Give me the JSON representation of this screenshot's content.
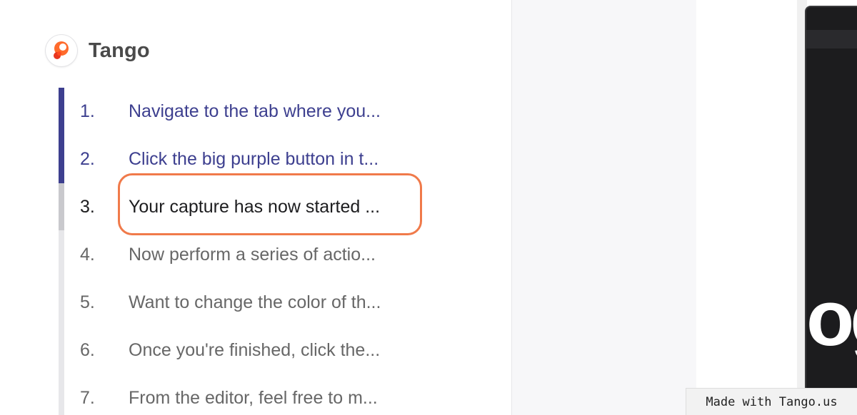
{
  "brand": {
    "name": "Tango"
  },
  "steps": [
    {
      "number": "1.",
      "text": "Navigate to the tab where you...",
      "state": "visited"
    },
    {
      "number": "2.",
      "text": "Click the big purple button in t...",
      "state": "visited"
    },
    {
      "number": "3.",
      "text": "Your capture has now started ...",
      "state": "current"
    },
    {
      "number": "4.",
      "text": "Now perform a series of actio...",
      "state": "upcoming"
    },
    {
      "number": "5.",
      "text": "Want to change the color of th...",
      "state": "upcoming"
    },
    {
      "number": "6.",
      "text": "Once you're finished, click the...",
      "state": "upcoming"
    },
    {
      "number": "7.",
      "text": "From the editor, feel free to m...",
      "state": "upcoming"
    }
  ],
  "progress": {
    "completed_steps": 2,
    "current_step": 3
  },
  "preview": {
    "visible_letters": "og"
  },
  "watermark": {
    "text": "Made with Tango.us"
  },
  "colors": {
    "accent": "#3d3f8f",
    "highlight": "#f07a4a",
    "brand_orange": "#ff6b2c"
  }
}
